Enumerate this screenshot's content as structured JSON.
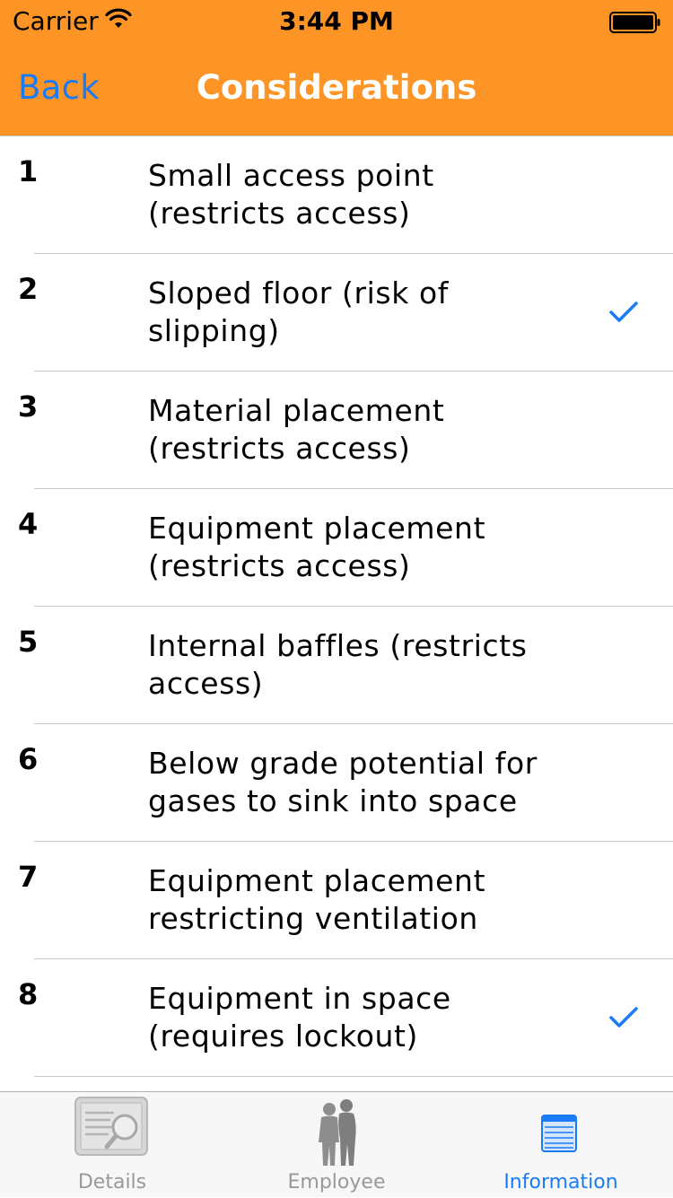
{
  "status_bar": {
    "carrier": "Carrier",
    "time": "3:44 PM"
  },
  "nav": {
    "back_label": "Back",
    "title": "Considerations"
  },
  "items": [
    {
      "number": "1",
      "text": "Small access point (restricts access)",
      "checked": false
    },
    {
      "number": "2",
      "text": "Sloped floor (risk of slipping)",
      "checked": true
    },
    {
      "number": "3",
      "text": "Material placement (restricts access)",
      "checked": false
    },
    {
      "number": "4",
      "text": "Equipment placement (restricts access)",
      "checked": false
    },
    {
      "number": "5",
      "text": "Internal baffles (restricts access)",
      "checked": false
    },
    {
      "number": "6",
      "text": "Below grade potential for gases to sink into space",
      "checked": false
    },
    {
      "number": "7",
      "text": "Equipment placement restricting ventilation",
      "checked": false
    },
    {
      "number": "8",
      "text": "Equipment in space (requires lockout)",
      "checked": true
    }
  ],
  "tabs": [
    {
      "label": "Details",
      "icon": "details-icon",
      "active": false
    },
    {
      "label": "Employee",
      "icon": "employee-icon",
      "active": false
    },
    {
      "label": "Information",
      "icon": "information-icon",
      "active": true
    }
  ],
  "colors": {
    "nav_background": "#fd9426",
    "accent": "#1a7cf5",
    "title": "#ffffff"
  }
}
